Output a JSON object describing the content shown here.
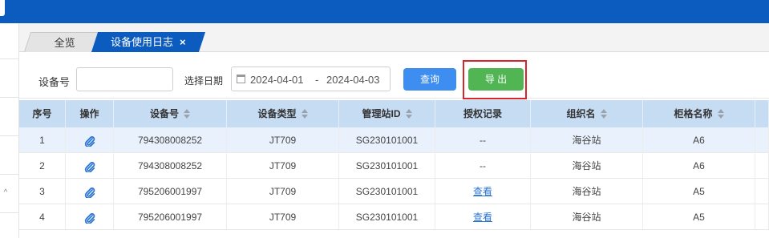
{
  "tabs": [
    {
      "label": "全览",
      "active": false
    },
    {
      "label": "设备使用日志",
      "active": true,
      "close": "×"
    }
  ],
  "filters": {
    "device_label": "设备号",
    "device_value": "",
    "date_label": "选择日期",
    "date_start": "2024-04-01",
    "date_separator": "-",
    "date_end": "2024-04-03",
    "query_button": "查询",
    "export_button": "导 出"
  },
  "table": {
    "columns": [
      "序号",
      "操作",
      "设备号",
      "设备类型",
      "管理站ID",
      "授权记录",
      "组织名",
      "柜格名称"
    ],
    "sortable": [
      false,
      false,
      true,
      true,
      true,
      false,
      true,
      true
    ],
    "rows": [
      {
        "index": "1",
        "device": "794308008252",
        "type": "JT709",
        "station": "SG230101001",
        "auth": "--",
        "auth_is_link": false,
        "org": "海谷站",
        "cell": "A6"
      },
      {
        "index": "2",
        "device": "794308008252",
        "type": "JT709",
        "station": "SG230101001",
        "auth": "--",
        "auth_is_link": false,
        "org": "海谷站",
        "cell": "A6"
      },
      {
        "index": "3",
        "device": "795206001997",
        "type": "JT709",
        "station": "SG230101001",
        "auth": "查看",
        "auth_is_link": true,
        "org": "海谷站",
        "cell": "A5"
      },
      {
        "index": "4",
        "device": "795206001997",
        "type": "JT709",
        "station": "SG230101001",
        "auth": "查看",
        "auth_is_link": true,
        "org": "海谷站",
        "cell": "A5"
      }
    ]
  },
  "colors": {
    "topbar": "#0c5cc0",
    "query": "#3d8ef0",
    "export": "#52b553",
    "highlight_frame": "#d8242b",
    "header_bg": "#c6dcf3",
    "link": "#2a74d3"
  },
  "icons": {
    "operation": "paperclip-icon",
    "sort": "sort-arrows-icon",
    "calendar": "calendar-icon",
    "collapse": "chevron-up-icon"
  }
}
